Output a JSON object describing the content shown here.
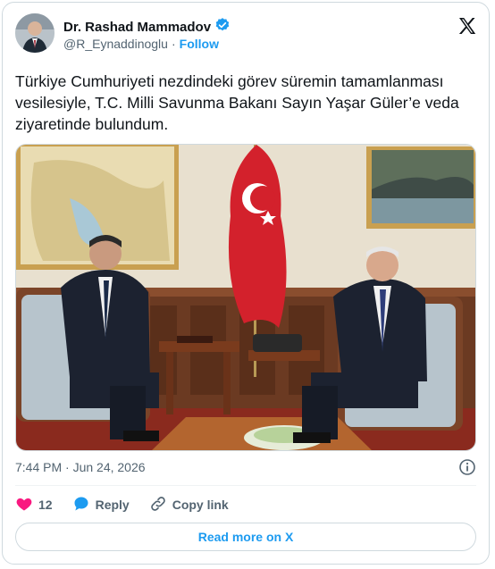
{
  "author": {
    "name": "Dr. Rashad Mammadov",
    "handle": "@R_Eynaddinoglu",
    "separator": "·",
    "follow_label": "Follow",
    "verified_color": "#1d9bf0"
  },
  "tweet": {
    "text": "Türkiye Cumhuriyeti nezdindeki görev süremin tamamlanması vesilesiyle, T.C. Milli Savunma Bakanı Sayın Yaşar Güler’e veda ziyaretinde bulundum.",
    "timestamp": "7:44 PM · Jun 24, 2026"
  },
  "actions": {
    "like_count": "12",
    "reply_label": "Reply",
    "copy_label": "Copy link"
  },
  "footer": {
    "read_more_label": "Read more on X"
  },
  "colors": {
    "accent": "#1d9bf0",
    "like": "#f91880",
    "muted": "#536471"
  },
  "icons": {
    "verified": "verified-badge-icon",
    "x_logo": "x-logo-icon",
    "info": "info-icon",
    "like": "heart-icon",
    "reply": "speech-bubble-icon",
    "copy": "link-icon"
  }
}
